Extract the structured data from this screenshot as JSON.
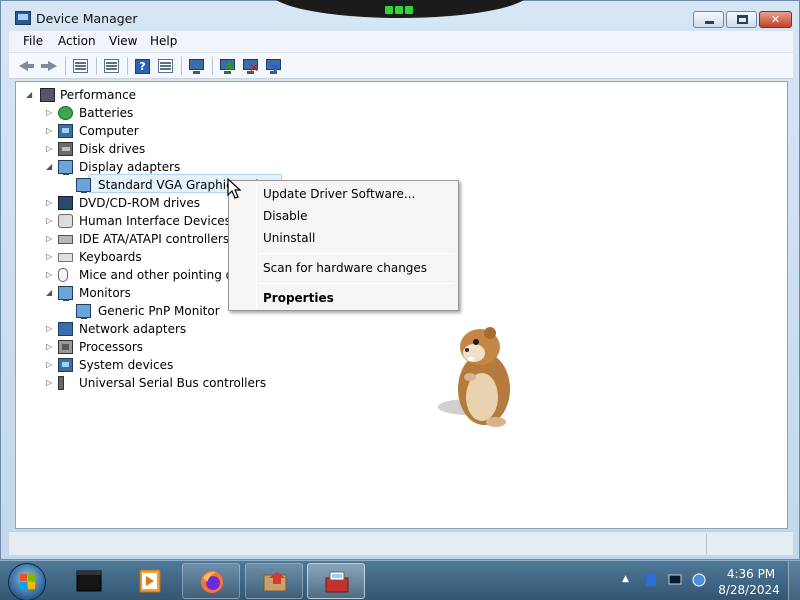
{
  "window": {
    "title": "Device Manager",
    "controls": {
      "minimize_icon": "minimize-icon",
      "maximize_icon": "maximize-icon",
      "close_glyph": "✕"
    }
  },
  "menu": [
    "File",
    "Action",
    "View",
    "Help"
  ],
  "toolbar": [
    "back-icon",
    "forward-icon",
    "console-tree-icon",
    "properties-icon",
    "help-icon",
    "action-pane-icon",
    "scan-hardware-icon",
    "update-driver-icon",
    "uninstall-icon",
    "disable-icon"
  ],
  "tree": {
    "root": "Performance",
    "items": [
      {
        "label": "Batteries",
        "icon": "battery-icon",
        "expanded": false
      },
      {
        "label": "Computer",
        "icon": "computer-icon",
        "expanded": false
      },
      {
        "label": "Disk drives",
        "icon": "disk-drive-icon",
        "expanded": false
      },
      {
        "label": "Display adapters",
        "icon": "display-adapter-icon",
        "expanded": true
      },
      {
        "label": "Standard VGA Graphics Adapter",
        "icon": "display-adapter-icon",
        "child": true
      },
      {
        "label": "DVD/CD-ROM drives",
        "icon": "dvd-drive-icon",
        "expanded": false
      },
      {
        "label": "Human Interface Devices",
        "icon": "hid-icon",
        "expanded": false
      },
      {
        "label": "IDE ATA/ATAPI controllers",
        "icon": "ide-controller-icon",
        "expanded": false
      },
      {
        "label": "Keyboards",
        "icon": "keyboard-icon",
        "expanded": false
      },
      {
        "label": "Mice and other pointing devices",
        "icon": "mouse-icon",
        "expanded": false
      },
      {
        "label": "Monitors",
        "icon": "monitor-icon",
        "expanded": true
      },
      {
        "label": "Generic PnP Monitor",
        "icon": "monitor-icon",
        "child": true
      },
      {
        "label": "Network adapters",
        "icon": "network-adapter-icon",
        "expanded": false
      },
      {
        "label": "Processors",
        "icon": "processor-icon",
        "expanded": false
      },
      {
        "label": "System devices",
        "icon": "system-devices-icon",
        "expanded": false
      },
      {
        "label": "Universal Serial Bus controllers",
        "icon": "usb-icon",
        "expanded": false
      }
    ]
  },
  "context_menu": {
    "items": [
      "Update Driver Software...",
      "Disable",
      "Uninstall",
      "Scan for hardware changes",
      "Properties"
    ]
  },
  "taskbar": {
    "apps": [
      "terminal-icon",
      "media-player-icon",
      "firefox-icon",
      "file-manager-icon",
      "device-manager-icon"
    ],
    "tray": [
      "show-hidden-icons-icon",
      "bluetooth-icon",
      "display-icon",
      "network-icon"
    ],
    "time": "4:36 PM",
    "date": "8/28/2024"
  },
  "colors": {
    "title_bar": "#c3d8ec",
    "selection": "#e5f1fb",
    "taskbar": "#335672",
    "close_button": "#c2402a"
  }
}
